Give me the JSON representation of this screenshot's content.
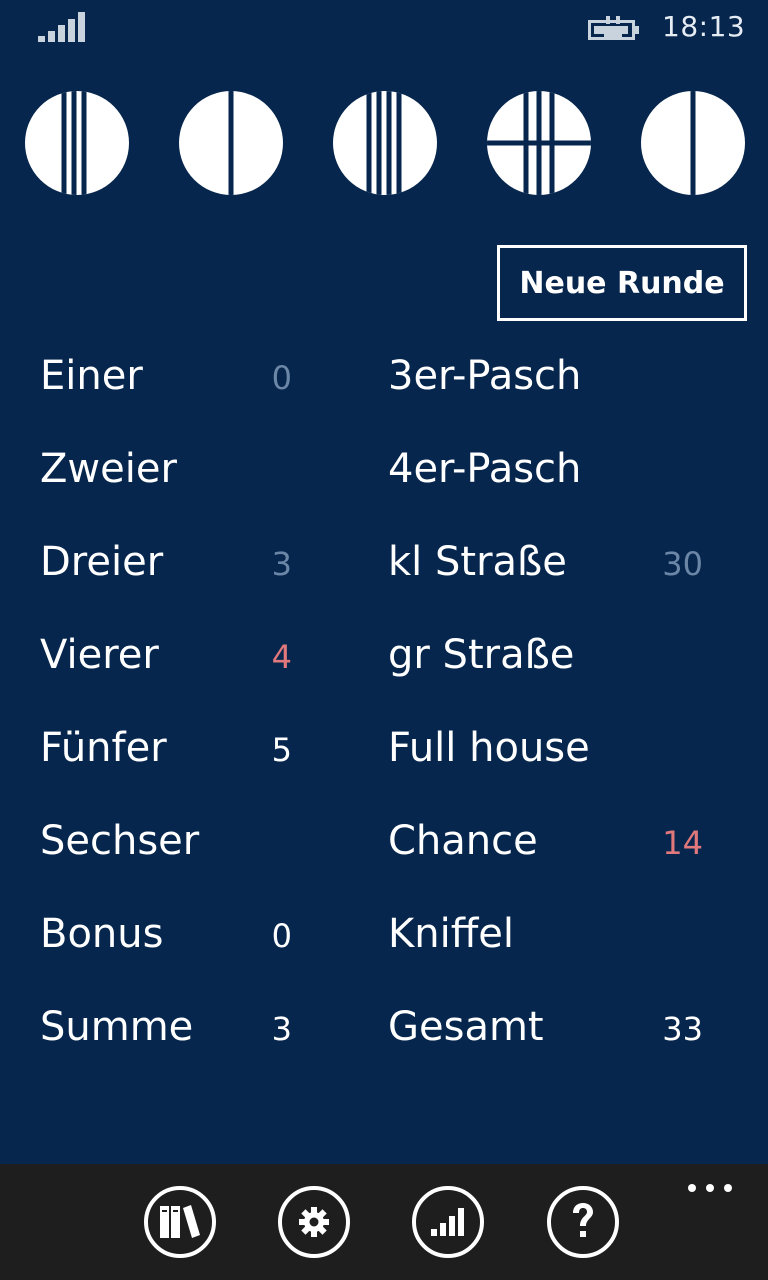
{
  "status": {
    "time": "18:13"
  },
  "dice": [
    {
      "name": "die-1",
      "value": 4
    },
    {
      "name": "die-2",
      "value": 2
    },
    {
      "name": "die-3",
      "value": 5
    },
    {
      "name": "die-4",
      "value": 6
    },
    {
      "name": "die-5",
      "value": 2
    }
  ],
  "actions": {
    "new_round": "Neue Runde"
  },
  "scores": {
    "left": [
      {
        "label": "Einer",
        "value": "0",
        "style": "dim"
      },
      {
        "label": "Zweier",
        "value": "",
        "style": ""
      },
      {
        "label": "Dreier",
        "value": "3",
        "style": "dim"
      },
      {
        "label": "Vierer",
        "value": "4",
        "style": "red"
      },
      {
        "label": "Fünfer",
        "value": "5",
        "style": "white"
      },
      {
        "label": "Sechser",
        "value": "",
        "style": ""
      },
      {
        "label": "Bonus",
        "value": "0",
        "style": "white"
      },
      {
        "label": "Summe",
        "value": "3",
        "style": "white"
      }
    ],
    "right": [
      {
        "label": "3er-Pasch",
        "value": "",
        "style": ""
      },
      {
        "label": "4er-Pasch",
        "value": "",
        "style": ""
      },
      {
        "label": "kl Straße",
        "value": "30",
        "style": "dim"
      },
      {
        "label": "gr Straße",
        "value": "",
        "style": ""
      },
      {
        "label": "Full house",
        "value": "",
        "style": ""
      },
      {
        "label": "Chance",
        "value": "14",
        "style": "red"
      },
      {
        "label": "Kniffel",
        "value": "",
        "style": ""
      },
      {
        "label": "Gesamt",
        "value": "33",
        "style": "white"
      }
    ]
  },
  "appbar": {
    "buttons": [
      {
        "name": "library-button",
        "icon": "books-icon"
      },
      {
        "name": "settings-button",
        "icon": "gear-icon"
      },
      {
        "name": "statistics-button",
        "icon": "bar-chart-icon"
      },
      {
        "name": "help-button",
        "icon": "question-icon"
      }
    ],
    "more_icon": "ellipsis-icon"
  },
  "colors": {
    "background": "#06264d",
    "appbar": "#1e1e1e",
    "dim_value": "#6b86a6",
    "highlight_value": "#e0787c",
    "text": "#ffffff"
  }
}
